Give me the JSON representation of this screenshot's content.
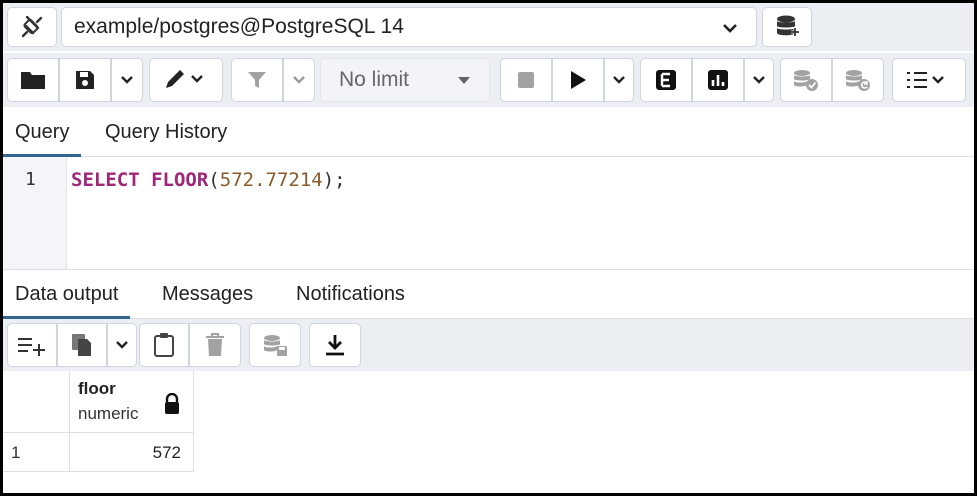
{
  "connection": {
    "label": "example/postgres@PostgreSQL 14",
    "icons": [
      "lightning-icon",
      "chevron-down-icon",
      "database-icon"
    ]
  },
  "toolbar": {
    "limit_label": "No limit",
    "icons": [
      "folder-icon",
      "save-icon",
      "pen-icon",
      "filter-icon",
      "stop-icon",
      "play-icon",
      "explain-icon",
      "chart-icon",
      "commit-icon",
      "rollback-icon",
      "macros-icon"
    ]
  },
  "query_tabs": [
    {
      "label": "Query"
    },
    {
      "label": "Query History"
    }
  ],
  "editor": {
    "line_number": "1",
    "keyword_select": "SELECT",
    "keyword_floor": "FLOOR",
    "open_paren": "(",
    "argument": "572.77214",
    "close": ");"
  },
  "output_tabs": [
    {
      "label": "Data output"
    },
    {
      "label": "Messages"
    },
    {
      "label": "Notifications"
    }
  ],
  "result_grid": {
    "columns": [
      {
        "name": "floor",
        "type": "numeric"
      }
    ],
    "rows": [
      {
        "row_number": "1",
        "values": [
          "572"
        ]
      }
    ]
  },
  "colors": {
    "keyword": "#a0267a",
    "number": "#8a5a2b",
    "active_tab": "#326690"
  }
}
